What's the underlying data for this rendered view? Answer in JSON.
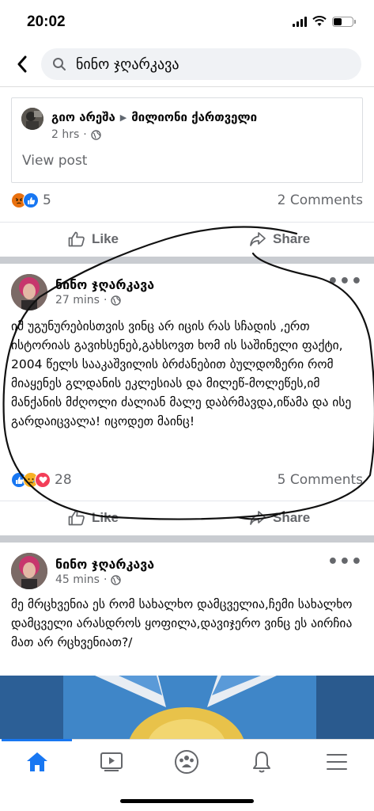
{
  "status_bar": {
    "time": "20:02"
  },
  "search": {
    "query": "ნინო ჯღარკავა"
  },
  "shared_post": {
    "author": "გიო არეშა",
    "group": "მილიონი ქართველი",
    "time": "2 hrs",
    "view_post_label": "View post",
    "reaction_count": "5",
    "comments_label": "2 Comments"
  },
  "actions": {
    "like_label": "Like",
    "share_label": "Share"
  },
  "post1": {
    "author": "ნინო ჯღარკავა",
    "time": "27 mins",
    "text": "იმ უგუნურებისთვის ვინც არ იცის რას სჩადის ,ერთ ისტორიას გავიხსენებ,გახსოვთ ხომ ის საშინელი ფაქტი, 2004 წელს სააკაშვილის ბრძანებით ბულდოზერი რომ მიაყენეს გლდანის ეკლესიას და მილეწ-მოლეწეს,იმ მანქანის მძღოლი  ძალიან მალე დაბრმავდა,იწამა და ისე გარდაიცვალა! იცოდეთ მაინც!",
    "reaction_count": "28",
    "comments_label": "5 Comments"
  },
  "post2": {
    "author": "ნინო ჯღარკავა",
    "time": "45 mins",
    "text": "მე მრცხვენია ეს რომ   სახალხო დამცველია,ჩემი სახალხო  დამცველი არასდროს ყოფილა,დავიჯერო ვინც ეს აირჩია მათ არ რცხვენიათ?/"
  },
  "colors": {
    "accent": "#1877f2",
    "like_blue": "#1877f2",
    "love_red": "#f33e58",
    "angry_orange": "#e9710f",
    "sad_yellow": "#f7b125"
  },
  "nav": [
    "home-icon",
    "video-icon",
    "groups-icon",
    "bell-icon",
    "menu-icon"
  ]
}
